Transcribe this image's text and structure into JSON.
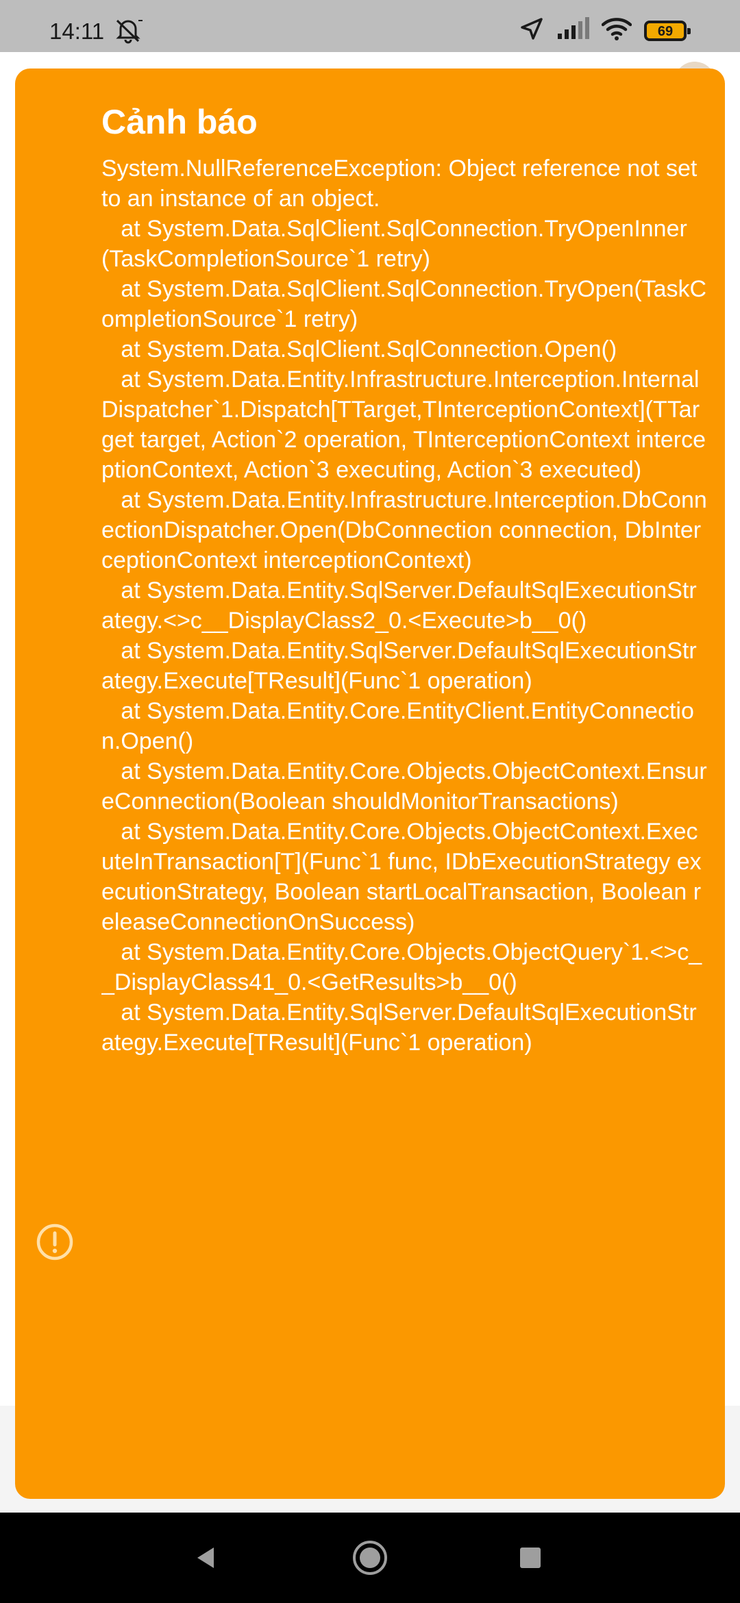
{
  "status_bar": {
    "time": "14:11",
    "battery_level": "69",
    "icons": [
      "mute-icon",
      "location-arrow-icon",
      "signal-icon",
      "wifi-icon",
      "battery-icon"
    ]
  },
  "dialog": {
    "title": "Cảnh báo",
    "message": "System.NullReferenceException: Object reference not set to an instance of an object.\n   at System.Data.SqlClient.SqlConnection.TryOpenInner(TaskCompletionSource`1 retry)\n   at System.Data.SqlClient.SqlConnection.TryOpen(TaskCompletionSource`1 retry)\n   at System.Data.SqlClient.SqlConnection.Open()\n   at System.Data.Entity.Infrastructure.Interception.InternalDispatcher`1.Dispatch[TTarget,TInterceptionContext](TTarget target, Action`2 operation, TInterceptionContext interceptionContext, Action`3 executing, Action`3 executed)\n   at System.Data.Entity.Infrastructure.Interception.DbConnectionDispatcher.Open(DbConnection connection, DbInterceptionContext interceptionContext)\n   at System.Data.Entity.SqlServer.DefaultSqlExecutionStrategy.<>c__DisplayClass2_0.<Execute>b__0()\n   at System.Data.Entity.SqlServer.DefaultSqlExecutionStrategy.Execute[TResult](Func`1 operation)\n   at System.Data.Entity.Core.EntityClient.EntityConnection.Open()\n   at System.Data.Entity.Core.Objects.ObjectContext.EnsureConnection(Boolean shouldMonitorTransactions)\n   at System.Data.Entity.Core.Objects.ObjectContext.ExecuteInTransaction[T](Func`1 func, IDbExecutionStrategy executionStrategy, Boolean startLocalTransaction, Boolean releaseConnectionOnSuccess)\n   at System.Data.Entity.Core.Objects.ObjectQuery`1.<>c__DisplayClass41_0.<GetResults>b__0()\n   at System.Data.Entity.SqlServer.DefaultSqlExecutionStrategy.Execute[TResult](Func`1 operation)",
    "background_color": "#fb9800",
    "icon": "warning-circle-icon"
  },
  "nav_bar": {
    "buttons": [
      "back-icon",
      "home-icon",
      "recents-icon"
    ]
  }
}
